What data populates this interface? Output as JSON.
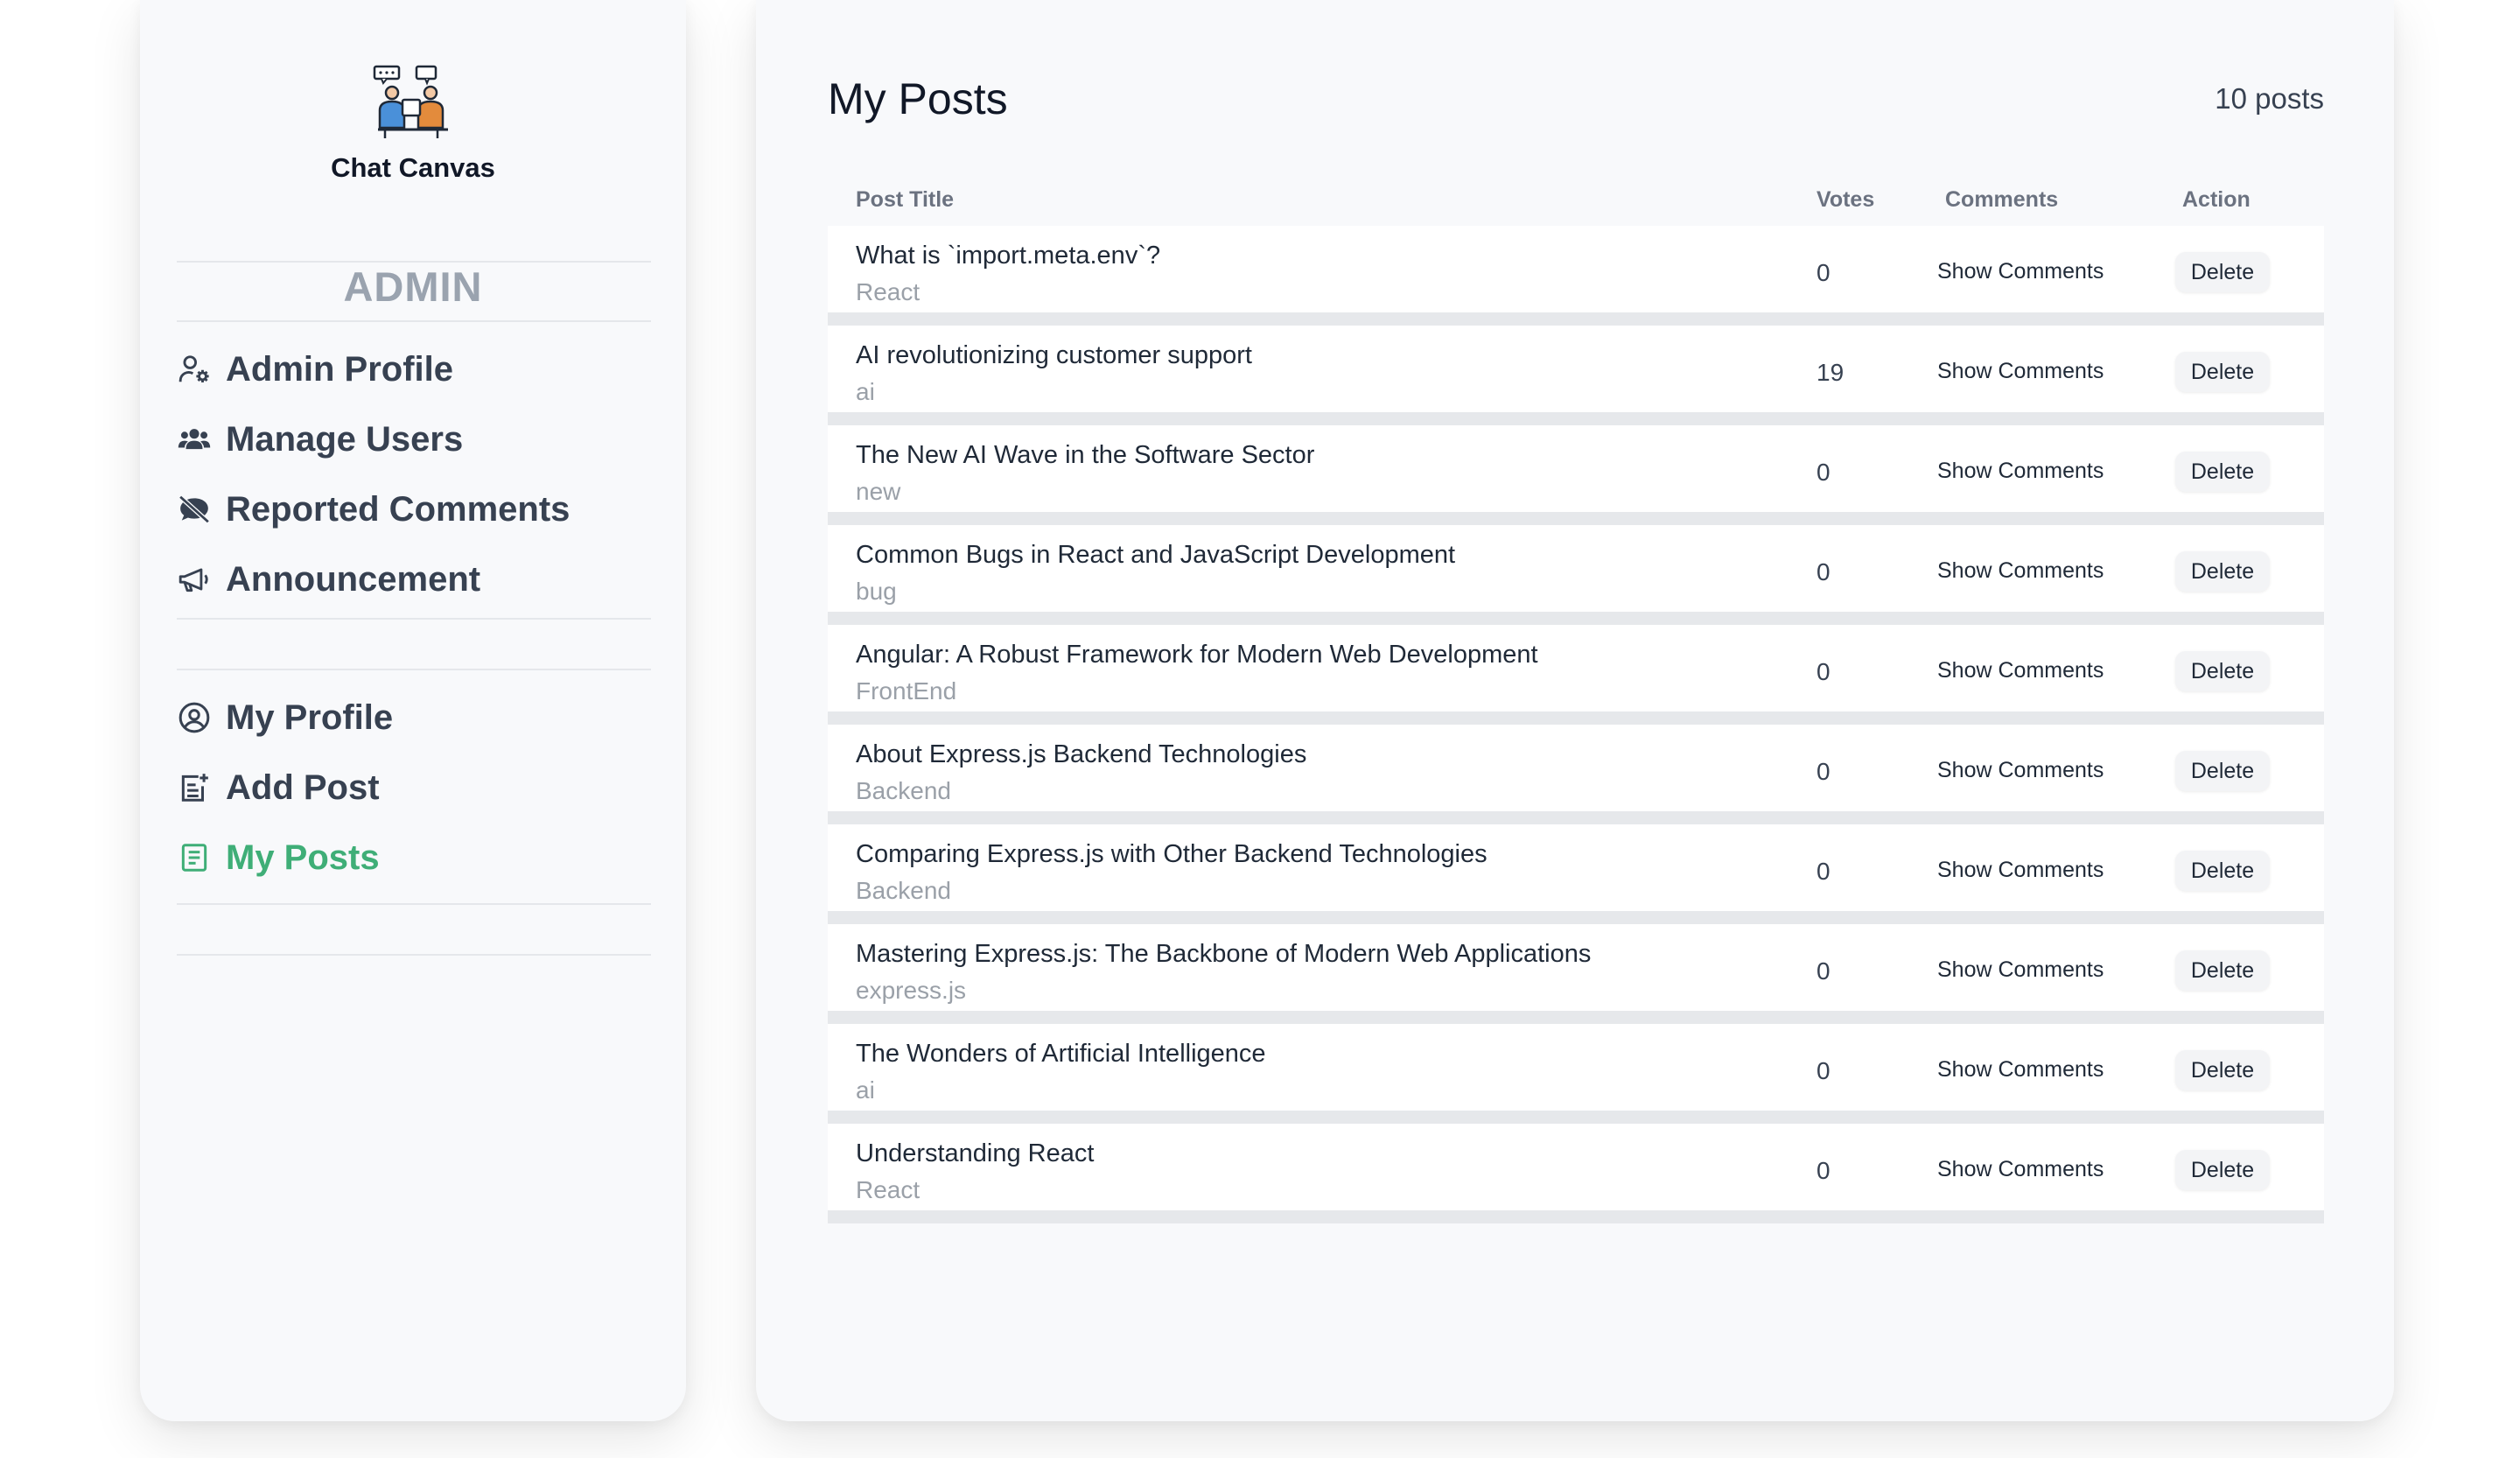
{
  "sidebar": {
    "brand_name": "Chat Canvas",
    "section_title": "ADMIN",
    "admin_items": [
      {
        "label": "Admin Profile",
        "icon": "admin-gear-icon"
      },
      {
        "label": "Manage Users",
        "icon": "users-icon"
      },
      {
        "label": "Reported Comments",
        "icon": "muted-comment-icon"
      },
      {
        "label": "Announcement",
        "icon": "megaphone-icon"
      }
    ],
    "user_items": [
      {
        "label": "My Profile",
        "icon": "user-circle-icon"
      },
      {
        "label": "Add Post",
        "icon": "add-post-icon"
      },
      {
        "label": "My Posts",
        "icon": "posts-list-icon",
        "active": true
      }
    ],
    "active_color": "#3fae77"
  },
  "main": {
    "title": "My Posts",
    "post_count": "10 posts",
    "columns": {
      "title": "Post Title",
      "votes": "Votes",
      "comments": "Comments",
      "action": "Action"
    },
    "rows": [
      {
        "title": "What is `import.meta.env`?",
        "tag": "React",
        "votes": "0",
        "comments": "Show Comments",
        "action": "Delete"
      },
      {
        "title": "AI revolutionizing customer support",
        "tag": "ai",
        "votes": "19",
        "comments": "Show Comments",
        "action": "Delete"
      },
      {
        "title": "The New AI Wave in the Software Sector",
        "tag": "new",
        "votes": "0",
        "comments": "Show Comments",
        "action": "Delete"
      },
      {
        "title": "Common Bugs in React and JavaScript Development",
        "tag": "bug",
        "votes": "0",
        "comments": "Show Comments",
        "action": "Delete"
      },
      {
        "title": "Angular: A Robust Framework for Modern Web Development",
        "tag": "FrontEnd",
        "votes": "0",
        "comments": "Show Comments",
        "action": "Delete"
      },
      {
        "title": "About Express.js Backend Technologies",
        "tag": "Backend",
        "votes": "0",
        "comments": "Show Comments",
        "action": "Delete"
      },
      {
        "title": "Comparing Express.js with Other Backend Technologies",
        "tag": "Backend",
        "votes": "0",
        "comments": "Show Comments",
        "action": "Delete"
      },
      {
        "title": "Mastering Express.js: The Backbone of Modern Web Applications",
        "tag": "express.js",
        "votes": "0",
        "comments": "Show Comments",
        "action": "Delete"
      },
      {
        "title": "The Wonders of Artificial Intelligence",
        "tag": "ai",
        "votes": "0",
        "comments": "Show Comments",
        "action": "Delete"
      },
      {
        "title": "Understanding React",
        "tag": "React",
        "votes": "0",
        "comments": "Show Comments",
        "action": "Delete"
      }
    ]
  }
}
